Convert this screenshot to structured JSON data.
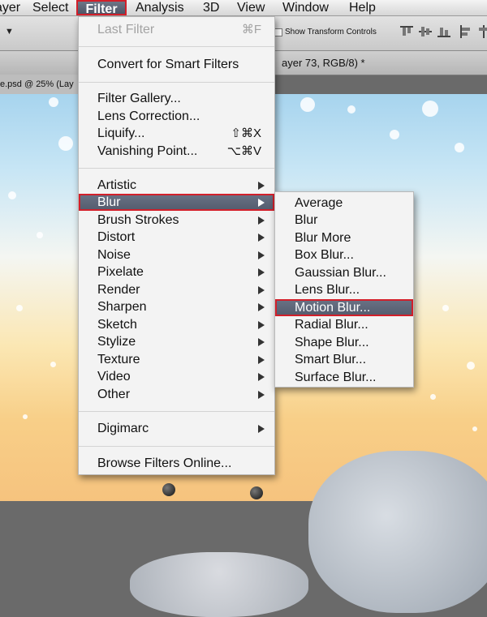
{
  "menubar": {
    "items": [
      "ayer",
      "Select",
      "Filter",
      "Analysis",
      "3D",
      "View",
      "Window",
      "Help"
    ]
  },
  "options_bar": {
    "checkbox_label": "Show Transform Controls"
  },
  "document": {
    "tab_title_partial": "ayer 73, RGB/8) *",
    "name_partial": "e.psd @ 25% (Lay"
  },
  "filter_menu": {
    "last_filter": {
      "label": "Last Filter",
      "shortcut": "⌘F"
    },
    "convert": "Convert for Smart Filters",
    "group1": [
      {
        "label": "Filter Gallery...",
        "shortcut": ""
      },
      {
        "label": "Lens Correction...",
        "shortcut": ""
      },
      {
        "label": "Liquify...",
        "shortcut": "⇧⌘X"
      },
      {
        "label": "Vanishing Point...",
        "shortcut": "⌥⌘V"
      }
    ],
    "submenus": [
      "Artistic",
      "Blur",
      "Brush Strokes",
      "Distort",
      "Noise",
      "Pixelate",
      "Render",
      "Sharpen",
      "Sketch",
      "Stylize",
      "Texture",
      "Video",
      "Other"
    ],
    "digimarc": "Digimarc",
    "browse": "Browse Filters Online..."
  },
  "blur_submenu": {
    "items": [
      "Average",
      "Blur",
      "Blur More",
      "Box Blur...",
      "Gaussian Blur...",
      "Lens Blur...",
      "Motion Blur...",
      "Radial Blur...",
      "Shape Blur...",
      "Smart Blur...",
      "Surface Blur..."
    ],
    "highlighted": "Motion Blur..."
  },
  "colors": {
    "highlight": "#5d6577",
    "highlight_outline": "#d21f2a"
  }
}
